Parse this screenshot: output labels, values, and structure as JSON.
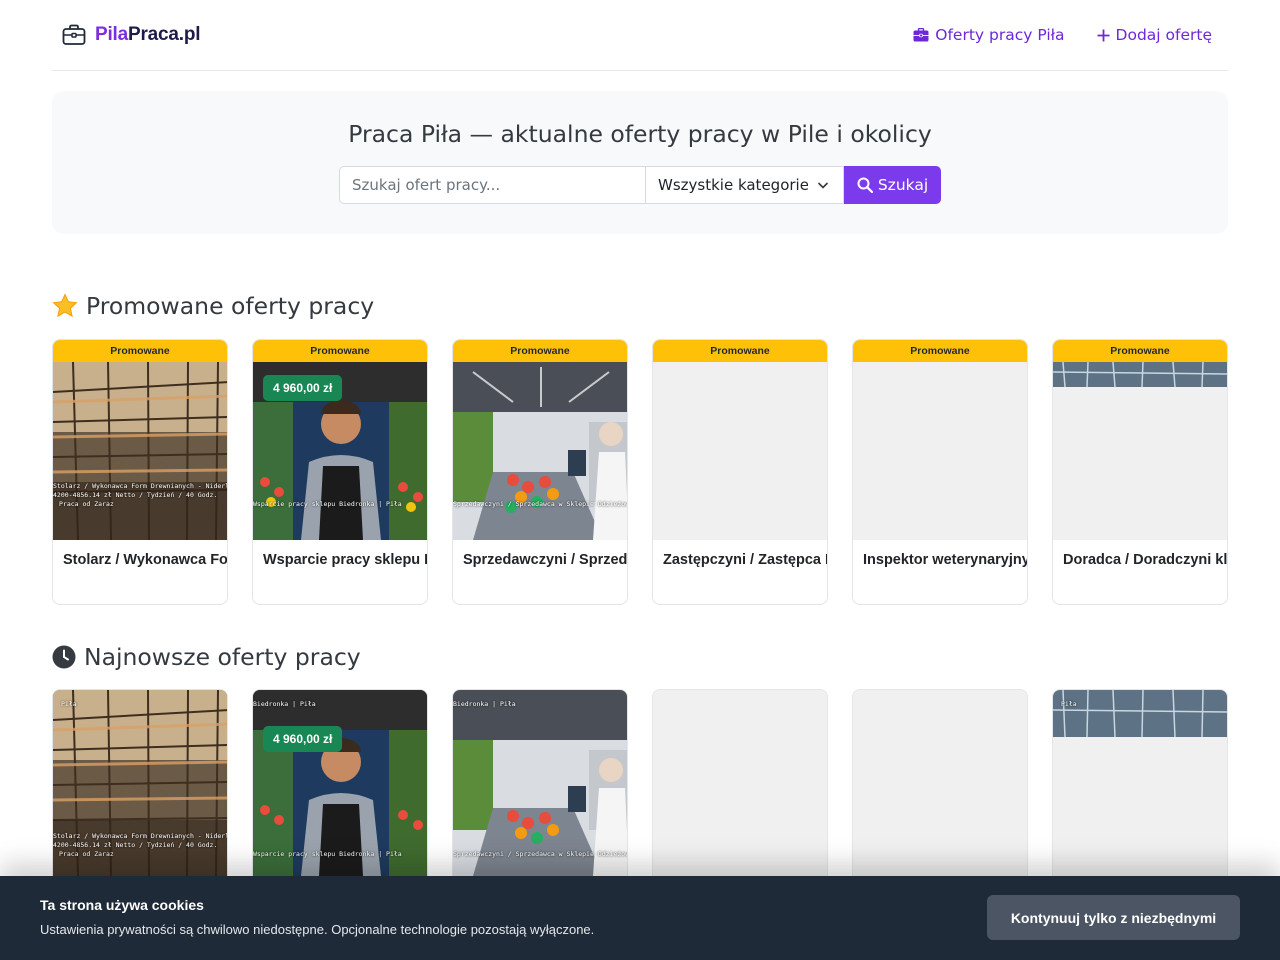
{
  "header": {
    "brand_part1": "Pila",
    "brand_part2": "Praca.pl",
    "nav": [
      {
        "label": "Oferty pracy Piła",
        "icon": "briefcase-icon"
      },
      {
        "label": "Dodaj ofertę",
        "icon": "plus-icon"
      }
    ],
    "accent_color": "#7c3aed"
  },
  "hero": {
    "title": "Praca Piła — aktualne oferty pracy w Pile i okolicy",
    "search_placeholder": "Szukaj ofert pracy...",
    "category_selected": "Wszystkie kategorie",
    "search_button": "Szukaj"
  },
  "promoted": {
    "title": "Promowane oferty pracy",
    "icon": "star-icon",
    "badge": "Promowane",
    "cards": [
      {
        "title": "Stolarz / Wykonawca Form Drewnianych",
        "salary": "",
        "caption_lines": [
          "Stolarz / Wykonawca Form Drewnianych - Niderlandy",
          "4200-4856.14 zł Netto / Tydzień / 40 Godz.",
          "Praca od Zaraz"
        ]
      },
      {
        "title": "Wsparcie pracy sklepu Biedronka",
        "salary": "4 960,00 zł",
        "caption_lines": [
          "Wsparcie pracy sklepu Biedronka | Piła"
        ]
      },
      {
        "title": "Sprzedawczyni / Sprzedawca",
        "salary": "",
        "caption_lines": [
          "Sprzedawczyni / Sprzedawca w Sklepie Odzieżowym"
        ]
      },
      {
        "title": "Zastępczyni / Zastępca Kierownika",
        "salary": "",
        "caption_lines": []
      },
      {
        "title": "Inspektor weterynaryjny",
        "salary": "",
        "caption_lines": []
      },
      {
        "title": "Doradca / Doradczyni klienta",
        "salary": "",
        "caption_lines": []
      }
    ]
  },
  "newest": {
    "title": "Najnowsze oferty pracy",
    "icon": "clock-icon",
    "cards": [
      {
        "salary": "",
        "top_caption": "Piła",
        "caption_lines": [
          "Stolarz / Wykonawca Form Drewnianych - Niderlandy",
          "4200-4856.14 zł Netto / Tydzień / 40 Godz.",
          "Praca od Zaraz"
        ]
      },
      {
        "salary": "4 960,00 zł",
        "top_caption": "Biedronka | Piła",
        "caption_lines": [
          "Wsparcie pracy sklepu Biedronka | Piła"
        ]
      },
      {
        "salary": "",
        "top_caption": "Biedronka | Piła",
        "caption_lines": [
          "Sprzedawczyni / Sprzedawca w Sklepie Odzieżowym"
        ]
      },
      {
        "salary": "",
        "top_caption": "",
        "caption_lines": []
      },
      {
        "salary": "",
        "top_caption": "",
        "caption_lines": []
      },
      {
        "salary": "",
        "top_caption": "Piła",
        "caption_lines": []
      }
    ]
  },
  "cookie": {
    "title": "Ta strona używa cookies",
    "text": "Ustawienia prywatności są chwilowo niedostępne. Opcjonalne technologie pozostają wyłączone.",
    "button": "Kontynuuj tylko z niezbędnymi"
  }
}
